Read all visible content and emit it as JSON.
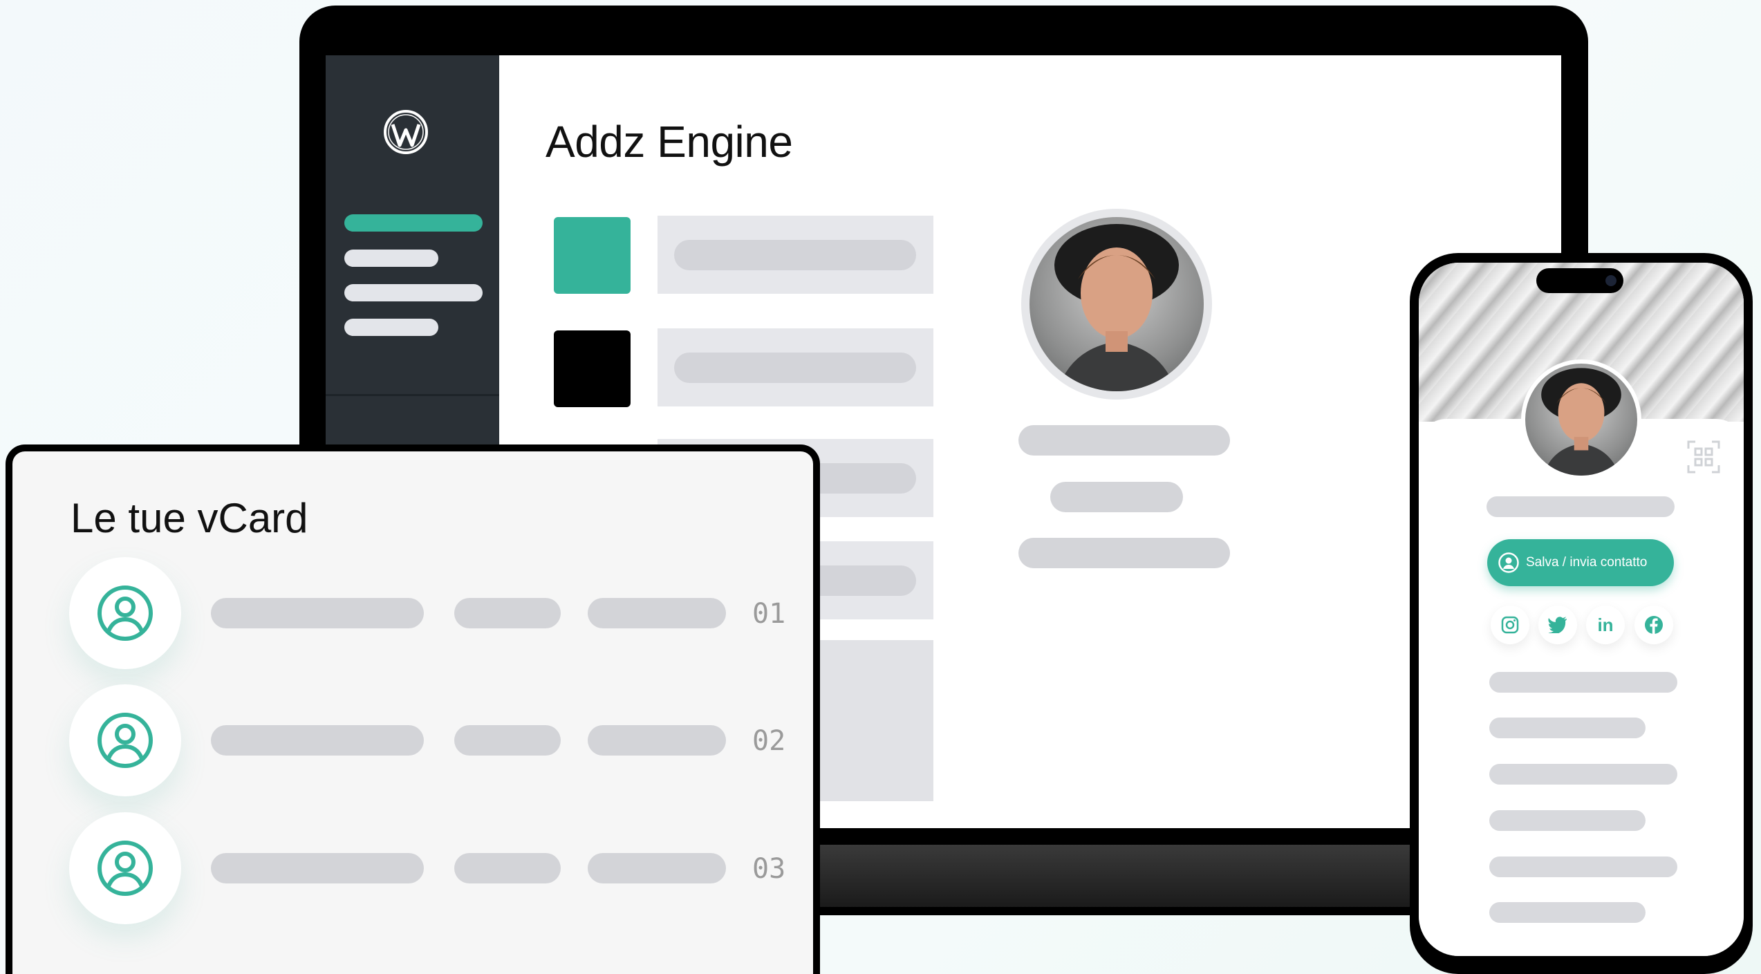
{
  "app": {
    "title": "Addz Engine"
  },
  "vcard_panel": {
    "title": "Le tue vCard",
    "rows": [
      {
        "number": "01"
      },
      {
        "number": "02"
      },
      {
        "number": "03"
      }
    ]
  },
  "phone": {
    "save_button_label": "Salva / invia contatto",
    "social_icons": [
      "instagram-icon",
      "twitter-icon",
      "linkedin-icon",
      "facebook-icon"
    ],
    "linkedin_text": "in"
  },
  "colors": {
    "accent": "#35b39a",
    "sidebar": "#2a3036",
    "placeholder": "#d3d4d8"
  }
}
